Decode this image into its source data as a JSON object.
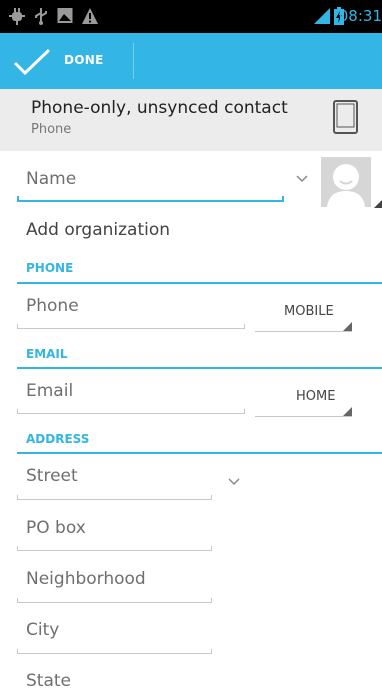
{
  "status_bar": {
    "time": "08:31",
    "left_icons": [
      "usb-debug-icon",
      "usb-icon",
      "image-icon",
      "warning-icon"
    ],
    "right_icons": [
      "signal-icon",
      "battery-charging-icon"
    ]
  },
  "action_bar": {
    "done_label": "DONE",
    "accent_color": "#33b5e5"
  },
  "account": {
    "title": "Phone-only, unsynced contact",
    "subtitle": "Phone",
    "icon": "phone-device-icon"
  },
  "name": {
    "placeholder": "Name",
    "expand_icon": "chevron-down-icon",
    "photo_icon": "contact-photo-icon"
  },
  "organization": {
    "label": "Add organization"
  },
  "phone_section": {
    "header": "PHONE",
    "placeholder": "Phone",
    "type": "MOBILE"
  },
  "email_section": {
    "header": "EMAIL",
    "placeholder": "Email",
    "type": "HOME"
  },
  "address_section": {
    "header": "ADDRESS",
    "fields": [
      "Street",
      "PO box",
      "Neighborhood",
      "City",
      "State"
    ]
  }
}
